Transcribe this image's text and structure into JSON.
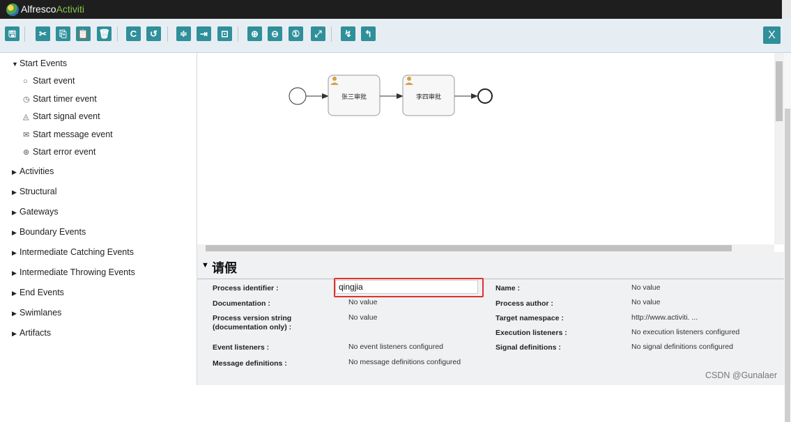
{
  "app": {
    "brand_first": "Alfresco",
    "brand_second": "Activiti"
  },
  "toolbar": {
    "buttons": [
      {
        "name": "save-icon",
        "glyph": "🖫"
      },
      {
        "name": "cut-icon",
        "glyph": "✂"
      },
      {
        "name": "copy-icon",
        "glyph": "⎘"
      },
      {
        "name": "paste-icon",
        "glyph": "📋"
      },
      {
        "name": "delete-icon",
        "glyph": "🗑"
      },
      {
        "name": "redo-icon",
        "glyph": "C"
      },
      {
        "name": "undo-icon",
        "glyph": "↺"
      },
      {
        "name": "align-horizontal-icon",
        "glyph": "≑"
      },
      {
        "name": "align-vertical-icon",
        "glyph": "⇥"
      },
      {
        "name": "same-size-icon",
        "glyph": "⊡"
      },
      {
        "name": "zoom-in-icon",
        "glyph": "⊕"
      },
      {
        "name": "zoom-out-icon",
        "glyph": "⊖"
      },
      {
        "name": "zoom-actual-icon",
        "glyph": "①"
      },
      {
        "name": "zoom-fit-icon",
        "glyph": "⤢"
      },
      {
        "name": "bend-add-icon",
        "glyph": "↯"
      },
      {
        "name": "bend-remove-icon",
        "glyph": "↰"
      }
    ],
    "close_label": "X"
  },
  "palette": {
    "start_events": {
      "label": "Start Events",
      "items": [
        {
          "label": "Start event",
          "icon": "start-event-icon",
          "glyph": "○"
        },
        {
          "label": "Start timer event",
          "icon": "timer-icon",
          "glyph": "◷"
        },
        {
          "label": "Start signal event",
          "icon": "signal-icon",
          "glyph": "◬"
        },
        {
          "label": "Start message event",
          "icon": "message-icon",
          "glyph": "✉"
        },
        {
          "label": "Start error event",
          "icon": "error-icon",
          "glyph": "⊛"
        }
      ]
    },
    "groups": [
      "Activities",
      "Structural",
      "Gateways",
      "Boundary Events",
      "Intermediate Catching Events",
      "Intermediate Throwing Events",
      "End Events",
      "Swimlanes",
      "Artifacts"
    ]
  },
  "diagram": {
    "tasks": [
      {
        "label": "张三审批"
      },
      {
        "label": "李四审批"
      }
    ]
  },
  "properties": {
    "title": "请假",
    "process_identifier_label": "Process identifier :",
    "process_identifier_value": "qingjia",
    "documentation_label": "Documentation :",
    "documentation_value": "No value",
    "version_label": "Process version string (documentation only) :",
    "version_value": "No value",
    "event_listeners_label": "Event listeners :",
    "event_listeners_value": "No event listeners configured",
    "message_definitions_label": "Message definitions :",
    "message_definitions_value": "No message definitions configured",
    "name_label": "Name :",
    "name_value": "No value",
    "author_label": "Process author :",
    "author_value": "No value",
    "namespace_label": "Target namespace :",
    "namespace_value": "http://www.activiti. ...",
    "exec_listeners_label": "Execution listeners :",
    "exec_listeners_value": "No execution listeners configured",
    "signal_definitions_label": "Signal definitions :",
    "signal_definitions_value": "No signal definitions configured"
  },
  "watermark": "CSDN @Gunalaer",
  "colors": {
    "toolbar_button": "#2f8f9a",
    "highlight_box": "#e03030"
  }
}
